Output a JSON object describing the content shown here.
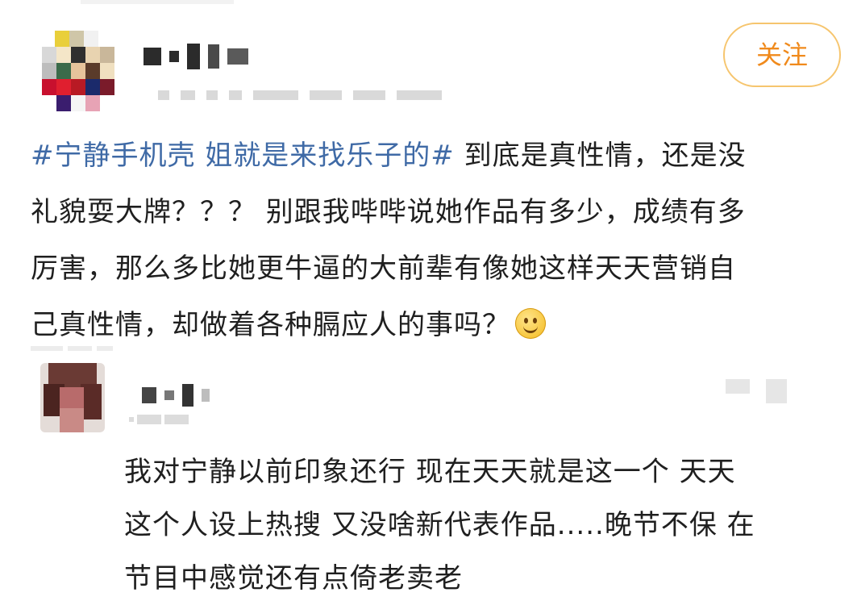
{
  "post": {
    "follow_label": "关注",
    "hashtag": "#宁静手机壳 姐就是来找乐子的#",
    "lines": [
      " 到底是真性情，还是没",
      "礼貌耍大牌？？？ 别跟我哔哔说她作品有多少，成绩有多",
      "厉害，那么多比她更牛逼的大前辈有像她这样天天营销自",
      "己真性情，却做着各种膈应人的事吗？"
    ],
    "emoji": "smile-emoji"
  },
  "comment": {
    "lines": [
      "我对宁静以前印象还行 现在天天就是这一个 天天",
      "这个人设上热搜 又没啥新代表作品.....晚节不保 在",
      "节目中感觉还有点倚老卖老"
    ]
  },
  "colors": {
    "hashtag": "#3f6aa6",
    "follow_text": "#f08a1c",
    "follow_border": "#f6c56e",
    "text": "#1f1f1f"
  }
}
